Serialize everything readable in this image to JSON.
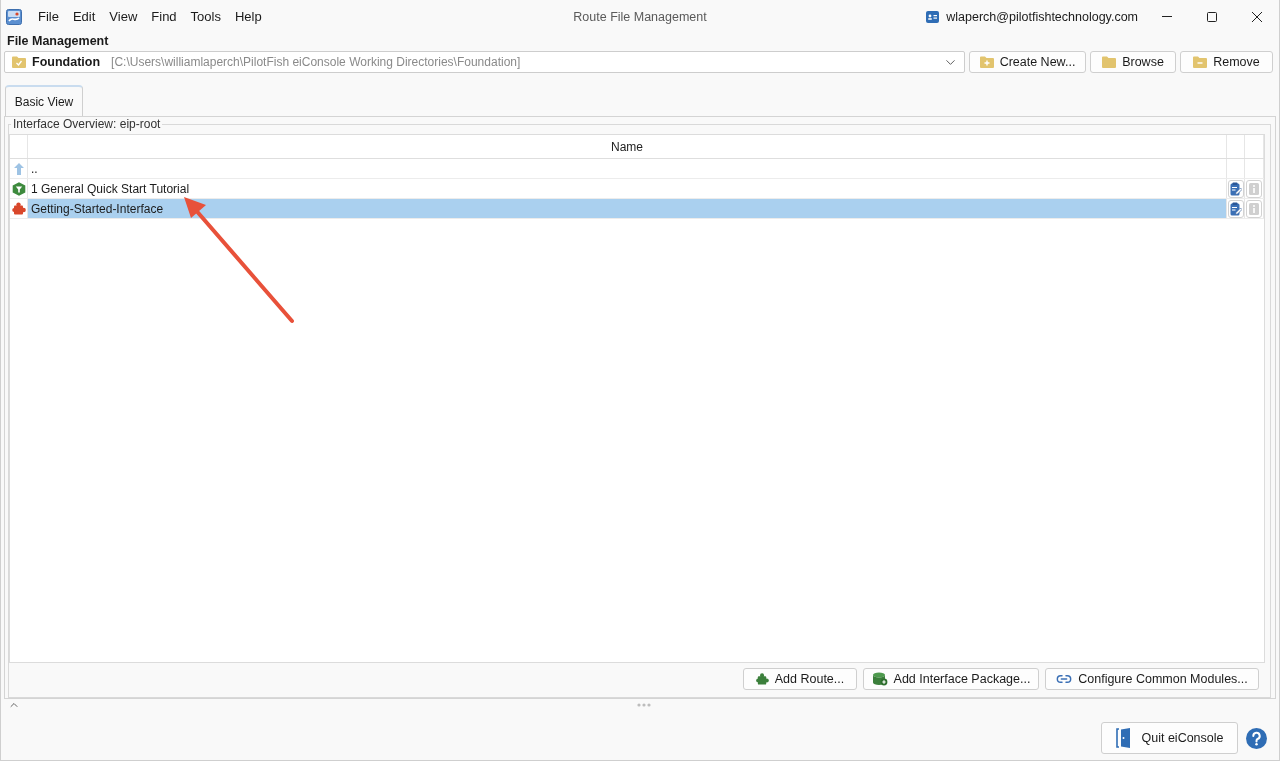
{
  "window": {
    "title": "Route File Management",
    "account": "wlaperch@pilotfishtechnology.com"
  },
  "menu": [
    "File",
    "Edit",
    "View",
    "Find",
    "Tools",
    "Help"
  ],
  "file_management": {
    "heading": "File Management",
    "workspace": {
      "name": "Foundation",
      "path": "[C:\\Users\\williamlaperch\\PilotFish eiConsole Working Directories\\Foundation]"
    },
    "buttons": [
      {
        "kind": "create",
        "label": "Create New..."
      },
      {
        "kind": "browse",
        "label": "Browse"
      },
      {
        "kind": "remove",
        "label": "Remove"
      }
    ]
  },
  "tabs": [
    {
      "label": "Basic View",
      "selected": true
    }
  ],
  "overview": {
    "title": "Interface Overview: eip-root",
    "table": {
      "columns": [
        "Name"
      ],
      "rows": [
        {
          "kind": "parent",
          "name": "..",
          "selected": false
        },
        {
          "kind": "package",
          "name": "1 General Quick Start Tutorial",
          "selected": false,
          "info_disabled": true
        },
        {
          "kind": "route",
          "name": "Getting-Started-Interface",
          "selected": true,
          "info_disabled": true
        }
      ]
    },
    "buttons": [
      {
        "kind": "route",
        "label": "Add Route..."
      },
      {
        "kind": "package",
        "label": "Add Interface Package..."
      },
      {
        "kind": "modules",
        "label": "Configure Common Modules..."
      }
    ]
  },
  "quit_button": "Quit eiConsole"
}
